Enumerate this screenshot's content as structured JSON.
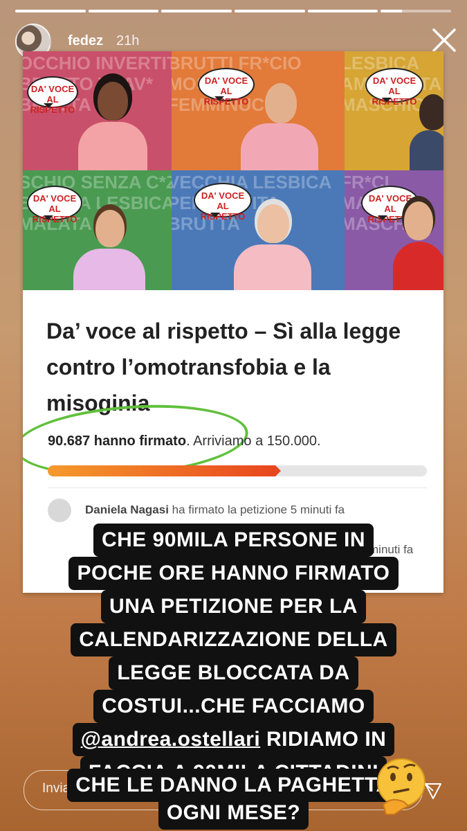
{
  "story": {
    "segments": [
      1.0,
      1.0,
      1.0,
      1.0,
      1.0,
      0.3
    ],
    "username": "fedez",
    "time": "21h"
  },
  "petition": {
    "banner_tiles": [
      {
        "bubble": "DA' VOCE AL\nRISPETTO",
        "bg": "#c9506a",
        "words": "OCCHIO INVERTITI\nBRUTTO TRAV*\nBRUTTA"
      },
      {
        "bubble": "DA' VOCE AL\nRISPETTO",
        "bg": "#e27a3a",
        "words": "BRUTTI FR*CIO\nMOSCIO\nFEMMINUCCIA"
      },
      {
        "bubble": "DA' VOCE AL\nRISPETTO",
        "bg": "#d6a534",
        "words": "LESBICA\nAMMALATA\nMASCHIO"
      },
      {
        "bubble": "DA' VOCE AL\nRISPETTO",
        "bg": "#4a9a52",
        "words": "SCHIO SENZA C*ZZ\nBRUTTA LESBICA\nMALATA"
      },
      {
        "bubble": "DA' VOCE AL\nRISPETTO",
        "bg": "#4b79b8",
        "words": "VECCHIA LESBICA\nPERVERTITA\nBRUTTA"
      },
      {
        "bubble": "DA' VOCE AL\nRISPETTO",
        "bg": "#8a5aa6",
        "words": "FR*CI\nMALATO\nMASCH"
      }
    ],
    "title": "Da’ voce al rispetto – Sì alla legge contro l’omotransfobia e la misoginia",
    "signed_count": "90.687 hanno firmato",
    "goal_text": ". Arriviamo a 150.000.",
    "progress_fraction": 0.6,
    "activity": [
      {
        "name": "Daniela Nagasi",
        "text": " ha firmato la petizione 5 minuti fa"
      },
      {
        "name": "",
        "text": "minuti fa"
      }
    ]
  },
  "caption": {
    "lines": [
      "CHE 90MILA PERSONE IN",
      "POCHE ORE HANNO FIRMATO",
      "UNA PETIZIONE PER LA",
      "CALENDARIZZAZIONE DELLA",
      "LEGGE BLOCCATA DA",
      "COSTUI...CHE FACCIAMO",
      "RIDIAMO IN",
      "FACCIA A 90MILA CITTADINI",
      "CHE LE DANNO LA PAGHETTA",
      "OGNI MESE?"
    ],
    "mention": "@andrea.ostellari"
  },
  "reply": {
    "placeholder": "Invia messaggio"
  },
  "icons": [
    "close-icon",
    "thinking-face-emoji",
    "send-icon"
  ]
}
